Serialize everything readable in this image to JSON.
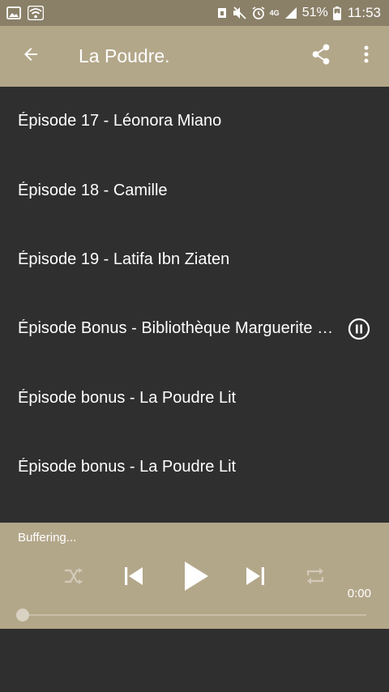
{
  "status_bar": {
    "network_label": "4G",
    "battery_text": "51%",
    "time": "11:53"
  },
  "app_bar": {
    "title": "La Poudre.",
    "icons": [
      "back-arrow-icon",
      "share-icon",
      "more-vert-icon"
    ]
  },
  "episodes": [
    {
      "title": "Épisode 17 - Léonora Miano",
      "playing": false
    },
    {
      "title": "Épisode 18 - Camille",
      "playing": false
    },
    {
      "title": "Épisode 19 - Latifa Ibn Ziaten",
      "playing": false
    },
    {
      "title": "Épisode Bonus - Bibliothèque Marguerite Durand",
      "playing": true
    },
    {
      "title": "Épisode bonus - La Poudre Lit",
      "playing": false
    },
    {
      "title": "Épisode bonus - La Poudre Lit",
      "playing": false
    }
  ],
  "player": {
    "status": "Buffering...",
    "time": "0:00",
    "progress": 0,
    "controls": [
      "shuffle-icon",
      "skip-previous-icon",
      "play-icon",
      "skip-next-icon",
      "repeat-icon"
    ]
  },
  "colors": {
    "accent": "#b3a78a",
    "status_bar": "#8a8068",
    "background": "#2f2f2f",
    "disabled_icon": "#d2cab8"
  }
}
